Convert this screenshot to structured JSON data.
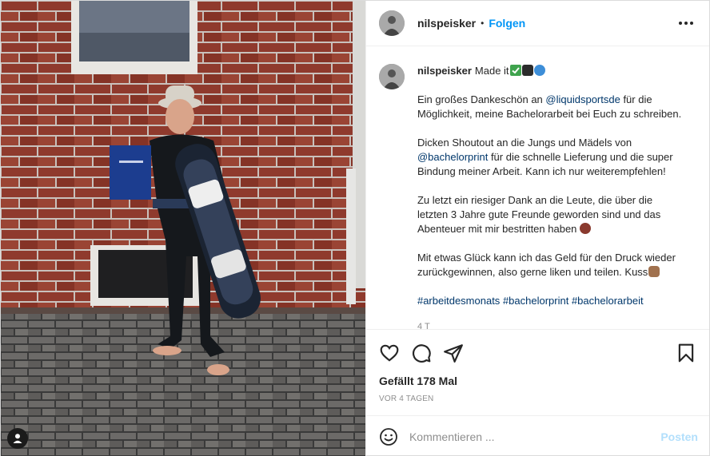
{
  "header": {
    "username": "nilspeisker",
    "separator": "•",
    "follow_label": "Folgen"
  },
  "caption": {
    "username": "nilspeisker",
    "intro": "Made it",
    "line1_before": "Ein großes Dankeschön an ",
    "mention1": "@liquidsportsde",
    "line1_after": " für die Möglichkeit, meine Bachelorarbeit bei Euch zu schreiben.",
    "line2_before": "Dicken Shoutout an die Jungs und Mädels von ",
    "mention2": "@bachelorprint",
    "line2_after": " für die schnelle Lieferung und die super Bindung meiner Arbeit. Kann ich nur weiterempfehlen!",
    "line3": "Zu letzt ein riesiger Dank an die Leute, die über die letzten 3 Jahre gute Freunde geworden sind und das Abenteuer mit mir bestritten haben",
    "line4": "Mit etwas Glück kann ich das Geld für den Druck wieder zurückgewinnen, also gerne liken und teilen. Kuss",
    "hashtags": [
      "#arbeitdesmonats",
      "#bachelorprint",
      "#bachelorarbeit"
    ],
    "partial_line": "4 T"
  },
  "icons": {
    "intro_emojis": [
      "check-mark-button-emoji",
      "graduate-emoji",
      "wave-emoji"
    ],
    "friends_emoji": "muscle-emoji",
    "kiss_emoji": "rock-hand-emoji",
    "actions": [
      "heart-icon",
      "comment-icon",
      "share-icon",
      "bookmark-icon"
    ],
    "user_tag": "user-tag-icon",
    "smiley": "emoji-smiley-icon"
  },
  "stats": {
    "likes": "Gefällt 178 Mal",
    "date": "VOR 4 TAGEN"
  },
  "comment_box": {
    "placeholder": "Kommentieren ...",
    "post_label": "Posten"
  },
  "colors": {
    "link_blue": "#0095f6",
    "mention_blue": "#00376b",
    "post_disabled": "#b2dffc",
    "muted": "#8e8e8e",
    "text": "#262626"
  }
}
